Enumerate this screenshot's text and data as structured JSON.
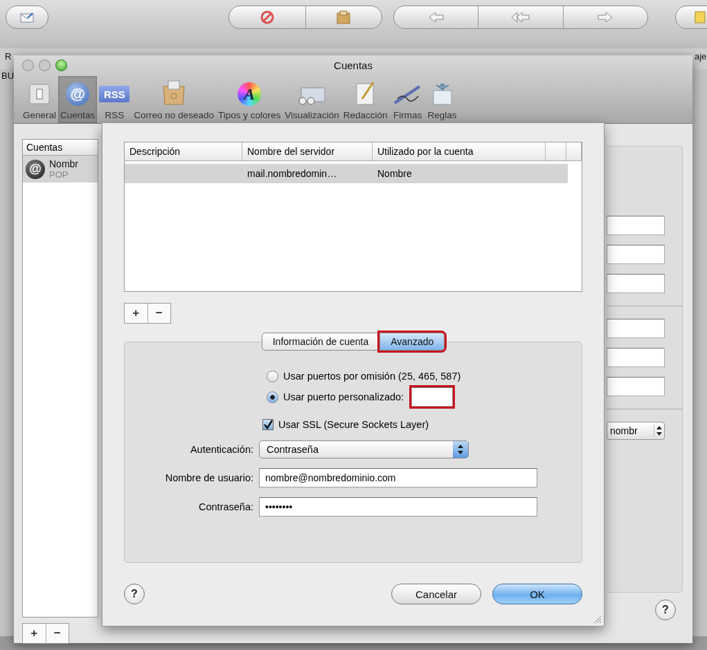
{
  "background_window": {
    "left_labels": [
      "R",
      "BU"
    ],
    "right_label": "aje"
  },
  "preferences": {
    "title": "Cuentas",
    "toolbar": [
      {
        "label": "General",
        "kind": "general",
        "selected": false
      },
      {
        "label": "Cuentas",
        "kind": "accounts",
        "glyph": "@",
        "selected": true
      },
      {
        "label": "RSS",
        "kind": "rss",
        "glyph": "RSS",
        "selected": false
      },
      {
        "label": "Correo no deseado",
        "kind": "junk",
        "selected": false
      },
      {
        "label": "Tipos y colores",
        "kind": "fonts",
        "glyph": "A",
        "selected": false
      },
      {
        "label": "Visualización",
        "kind": "viewing",
        "selected": false
      },
      {
        "label": "Redacción",
        "kind": "composing",
        "selected": false
      },
      {
        "label": "Firmas",
        "kind": "signatures",
        "selected": false
      },
      {
        "label": "Reglas",
        "kind": "rules",
        "selected": false
      }
    ],
    "accounts_list": {
      "header": "Cuentas",
      "items": [
        {
          "name": "Nombr",
          "type": "POP",
          "glyph": "@",
          "selected": true
        }
      ],
      "add_remove": [
        "+",
        "−"
      ]
    },
    "account_popup": {
      "value": "nombr"
    },
    "help_label": "?"
  },
  "sheet": {
    "table": {
      "columns": [
        "Descripción",
        "Nombre del servidor",
        "Utilizado por la cuenta"
      ],
      "rows": [
        {
          "server": "mail.nombredomin…",
          "used_by": "Nombre",
          "selected": true
        }
      ],
      "add_remove": [
        "+",
        "−"
      ]
    },
    "tabs": [
      {
        "label": "Información de cuenta",
        "selected": false,
        "highlighted": false
      },
      {
        "label": "Avanzado",
        "selected": true,
        "highlighted": true
      }
    ],
    "port_options": [
      {
        "label": "Usar puertos por omisión (25, 465, 587)",
        "selected": false
      },
      {
        "label": "Usar puerto personalizado:",
        "selected": true
      }
    ],
    "custom_port": {
      "highlighted": true
    },
    "ssl": {
      "label": "Usar SSL (Secure Sockets Layer)",
      "checked": true
    },
    "fields": [
      {
        "label": "Autenticación:",
        "kind": "popup",
        "value": "Contraseña"
      },
      {
        "label": "Nombre de usuario:",
        "kind": "text",
        "value": "nombre@nombredominio.com"
      },
      {
        "label": "Contraseña:",
        "kind": "text",
        "value": "••••••••"
      }
    ],
    "help_label": "?",
    "buttons": [
      {
        "label": "Cancelar",
        "default": false
      },
      {
        "label": "OK",
        "default": true
      }
    ]
  }
}
